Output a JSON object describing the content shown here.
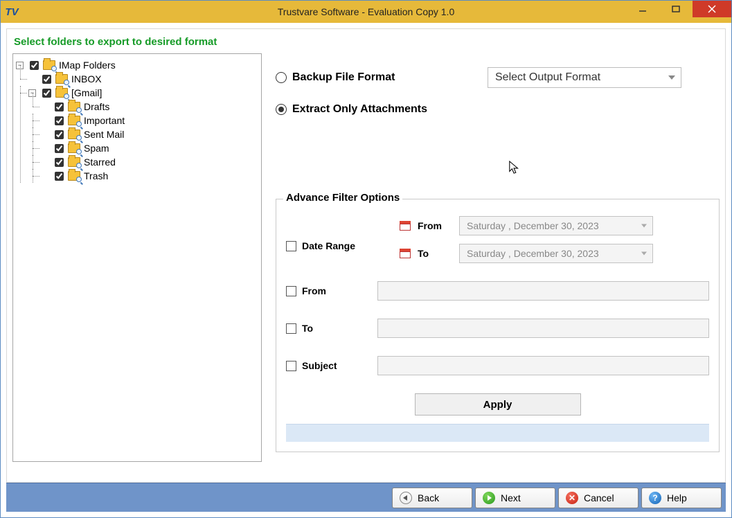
{
  "window": {
    "title": "Trustvare Software - Evaluation Copy 1.0",
    "logo": "TV"
  },
  "heading": "Select folders to export to desired format",
  "tree": {
    "root": {
      "label": "IMap Folders",
      "checked": true,
      "children": [
        {
          "label": "INBOX",
          "checked": true
        },
        {
          "label": "[Gmail]",
          "checked": true,
          "children": [
            {
              "label": "Drafts",
              "checked": true
            },
            {
              "label": "Important",
              "checked": true
            },
            {
              "label": "Sent Mail",
              "checked": true
            },
            {
              "label": "Spam",
              "checked": true
            },
            {
              "label": "Starred",
              "checked": true
            },
            {
              "label": "Trash",
              "checked": true
            }
          ]
        }
      ]
    }
  },
  "modes": {
    "backup_label": "Backup File Format",
    "extract_label": "Extract Only Attachments",
    "selected": "extract",
    "output_placeholder": "Select Output Format"
  },
  "filters": {
    "legend": "Advance Filter Options",
    "date_range_label": "Date Range",
    "from_label": "From",
    "to_label": "To",
    "from_date": "Saturday , December 30, 2023",
    "to_date": "Saturday , December 30, 2023",
    "from_field_label": "From",
    "to_field_label": "To",
    "subject_label": "Subject",
    "apply_label": "Apply"
  },
  "buttons": {
    "back": "Back",
    "next": "Next",
    "cancel": "Cancel",
    "help": "Help"
  }
}
